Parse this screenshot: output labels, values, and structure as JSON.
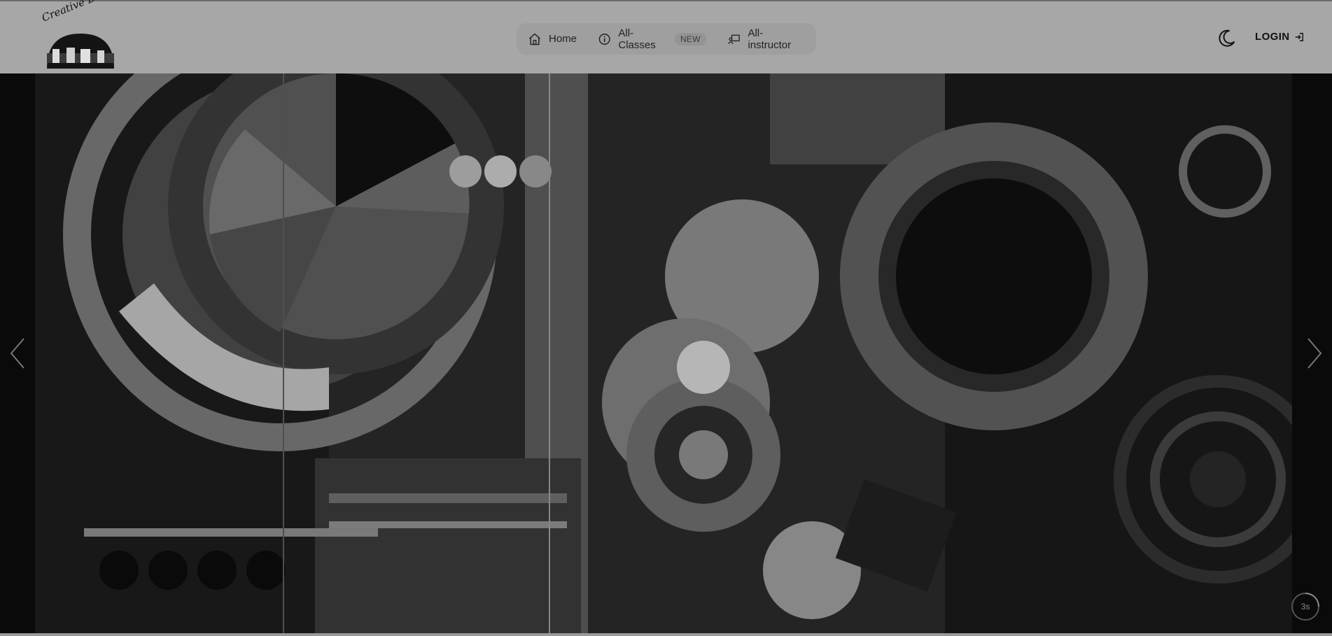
{
  "header": {
    "logo": {
      "text": "Creative Design",
      "icon": "logo-image"
    },
    "nav": [
      {
        "label": "Home",
        "icon": "home-icon"
      },
      {
        "label": "All-Classes",
        "icon": "info-icon",
        "badge": "NEW"
      },
      {
        "label": "All-instructor",
        "icon": "instructor-icon"
      }
    ],
    "theme_toggle_icon": "moon-icon",
    "login_label": "LOGIN",
    "login_icon": "login-arrow-icon"
  },
  "carousel": {
    "prev_icon": "chevron-left-icon",
    "next_icon": "chevron-right-icon",
    "timer_label": "3s",
    "image": "abstract-geometric-artwork"
  },
  "colors": {
    "overlay": "#8c8c8c",
    "header_bg": "#a7a7a7",
    "nav_pill_bg": "#9f9f9f"
  }
}
